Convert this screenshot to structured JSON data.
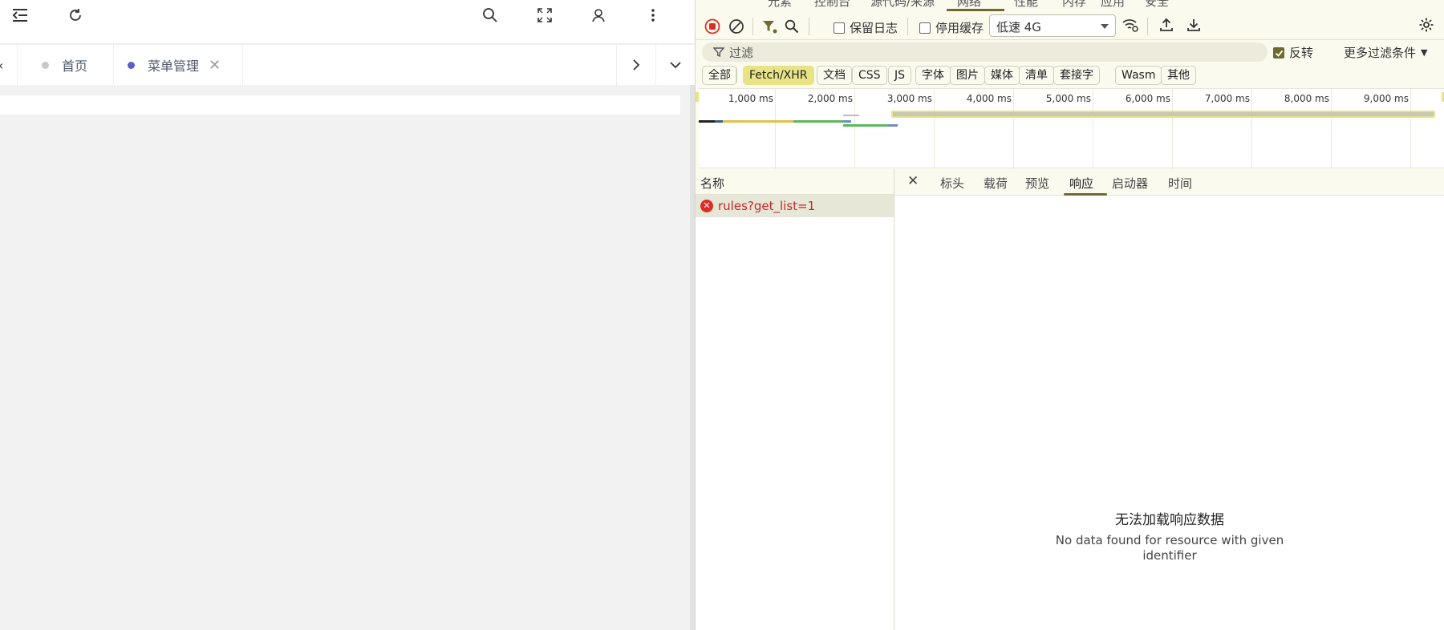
{
  "app": {
    "tabs": [
      {
        "label": "首页",
        "dot_color": "#c8c8c8"
      },
      {
        "label": "菜单管理",
        "dot_color": "#5b5fc7"
      }
    ]
  },
  "devtools": {
    "panel_tabs_cut": [
      "元素",
      "控制台",
      "源代码/来源",
      "网络",
      "性能",
      "内存",
      "应用",
      "安全"
    ],
    "toolbar": {
      "preserve_log": "保留日志",
      "disable_cache": "停用缓存",
      "throttle": "低速 4G"
    },
    "filter": {
      "placeholder": "过滤",
      "invert": "反转",
      "more_filters": "更多过滤条件"
    },
    "type_filters": [
      "全部",
      "Fetch/XHR",
      "文档",
      "CSS",
      "JS",
      "字体",
      "图片",
      "媒体",
      "清单",
      "套接字",
      "Wasm",
      "其他"
    ],
    "timeline_ticks": [
      "1,000 ms",
      "2,000 ms",
      "3,000 ms",
      "4,000 ms",
      "5,000 ms",
      "6,000 ms",
      "7,000 ms",
      "8,000 ms",
      "9,000 ms"
    ],
    "name_column": "名称",
    "request": {
      "name": "rules?get_list=1",
      "status": "error"
    },
    "detail_tabs": [
      "标头",
      "载荷",
      "预览",
      "响应",
      "启动器",
      "时间"
    ],
    "selected_detail_tab": "响应",
    "empty_title": "无法加载响应数据",
    "empty_desc_1": "No data found for resource with given",
    "empty_desc_2": "identifier"
  }
}
